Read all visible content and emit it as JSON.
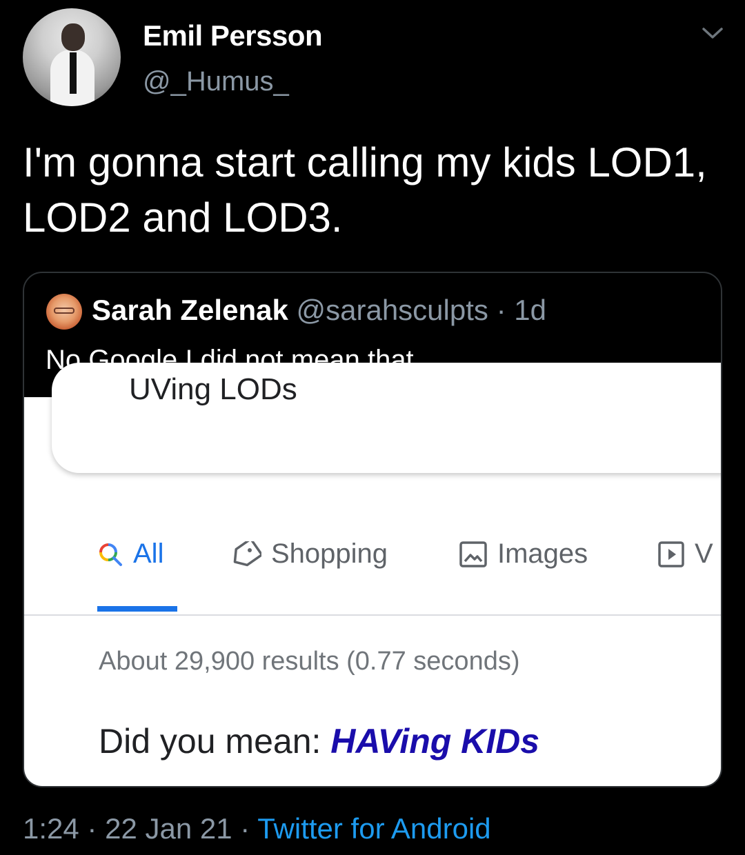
{
  "tweet": {
    "author_name": "Emil Persson",
    "author_handle": "@_Humus_",
    "text": "I'm gonna start calling my kids LOD1, LOD2 and LOD3.",
    "time": "1:24",
    "date": "22 Jan 21",
    "source": "Twitter for Android",
    "separator": "·"
  },
  "quote": {
    "author_name": "Sarah Zelenak",
    "author_handle": "@sarahsculpts",
    "age": "1d",
    "text": "No Google I did not mean that"
  },
  "google": {
    "query": "UVing LODs",
    "tabs": [
      {
        "label": "All",
        "icon": "search-icon",
        "active": true
      },
      {
        "label": "Shopping",
        "icon": "tag-icon",
        "active": false
      },
      {
        "label": "Images",
        "icon": "image-icon",
        "active": false
      },
      {
        "label": "V",
        "icon": "video-icon",
        "active": false
      }
    ],
    "result_stats": "About 29,900 results (0.77 seconds)",
    "did_you_mean_label": "Did you mean:",
    "did_you_mean_suggestion": "HAVing KIDs"
  },
  "colors": {
    "background": "#000000",
    "muted": "#8b98a5",
    "twitter_link": "#1d9bf0",
    "google_blue": "#1a73e8",
    "google_link": "#1a0dab"
  }
}
